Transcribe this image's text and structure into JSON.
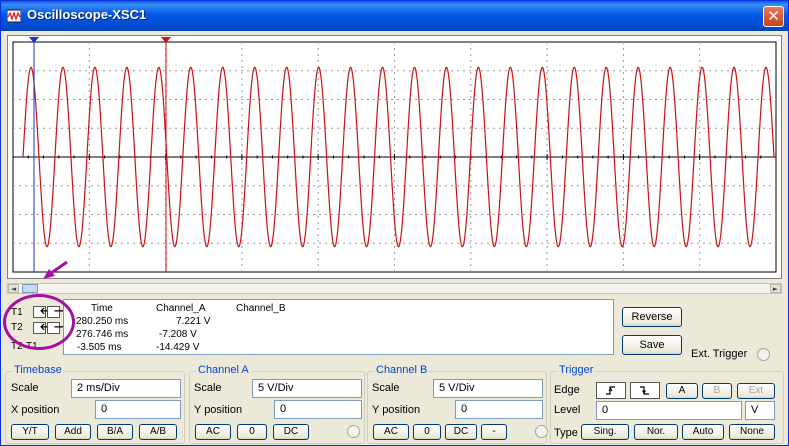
{
  "window": {
    "title": "Oscilloscope-XSC1",
    "close_glyph": "✕"
  },
  "colors": {
    "channel_a": "#cc1111",
    "cursor_t1": "#1a33cc",
    "cursor_t2": "#cc1111",
    "grid": "#9a9a9a",
    "highlight": "#a80fa0"
  },
  "waveform": {
    "cycles": 23.5,
    "amplitude_fraction": 0.78,
    "phase": "starts-at-zero-rising"
  },
  "readout": {
    "headers": {
      "time": "Time",
      "channel_a": "Channel_A",
      "channel_b": "Channel_B"
    },
    "rows": [
      {
        "label": "T1",
        "time": "280.250 ms",
        "channel_a": "7.221 V",
        "channel_b": ""
      },
      {
        "label": "T2",
        "time": "276.746 ms",
        "channel_a": "-7.208 V",
        "channel_b": ""
      },
      {
        "label": "T2-T1",
        "time": "-3.505 ms",
        "channel_a": "-14.429 V",
        "channel_b": ""
      }
    ],
    "arrow_left": "🡐",
    "arrow_right": "🡒"
  },
  "buttons": {
    "reverse": "Reverse",
    "save": "Save",
    "ext_trigger": "Ext. Trigger"
  },
  "timebase": {
    "title": "Timebase",
    "scale_label": "Scale",
    "scale_value": "2 ms/Div",
    "xpos_label": "X position",
    "xpos_value": "0",
    "modes": [
      "Y/T",
      "Add",
      "B/A",
      "A/B"
    ]
  },
  "channel_a": {
    "title": "Channel A",
    "scale_label": "Scale",
    "scale_value": "5  V/Div",
    "ypos_label": "Y position",
    "ypos_value": "0",
    "coupling": [
      "AC",
      "0",
      "DC"
    ]
  },
  "channel_b": {
    "title": "Channel B",
    "scale_label": "Scale",
    "scale_value": "5  V/Div",
    "ypos_label": "Y position",
    "ypos_value": "0",
    "coupling": [
      "AC",
      "0",
      "DC",
      "-"
    ]
  },
  "trigger": {
    "title": "Trigger",
    "edge_label": "Edge",
    "level_label": "Level",
    "level_value": "0",
    "level_unit": "V",
    "type_label": "Type",
    "source": [
      "A",
      "B",
      "Ext"
    ],
    "types": [
      "Sing.",
      "Nor.",
      "Auto",
      "None"
    ]
  }
}
